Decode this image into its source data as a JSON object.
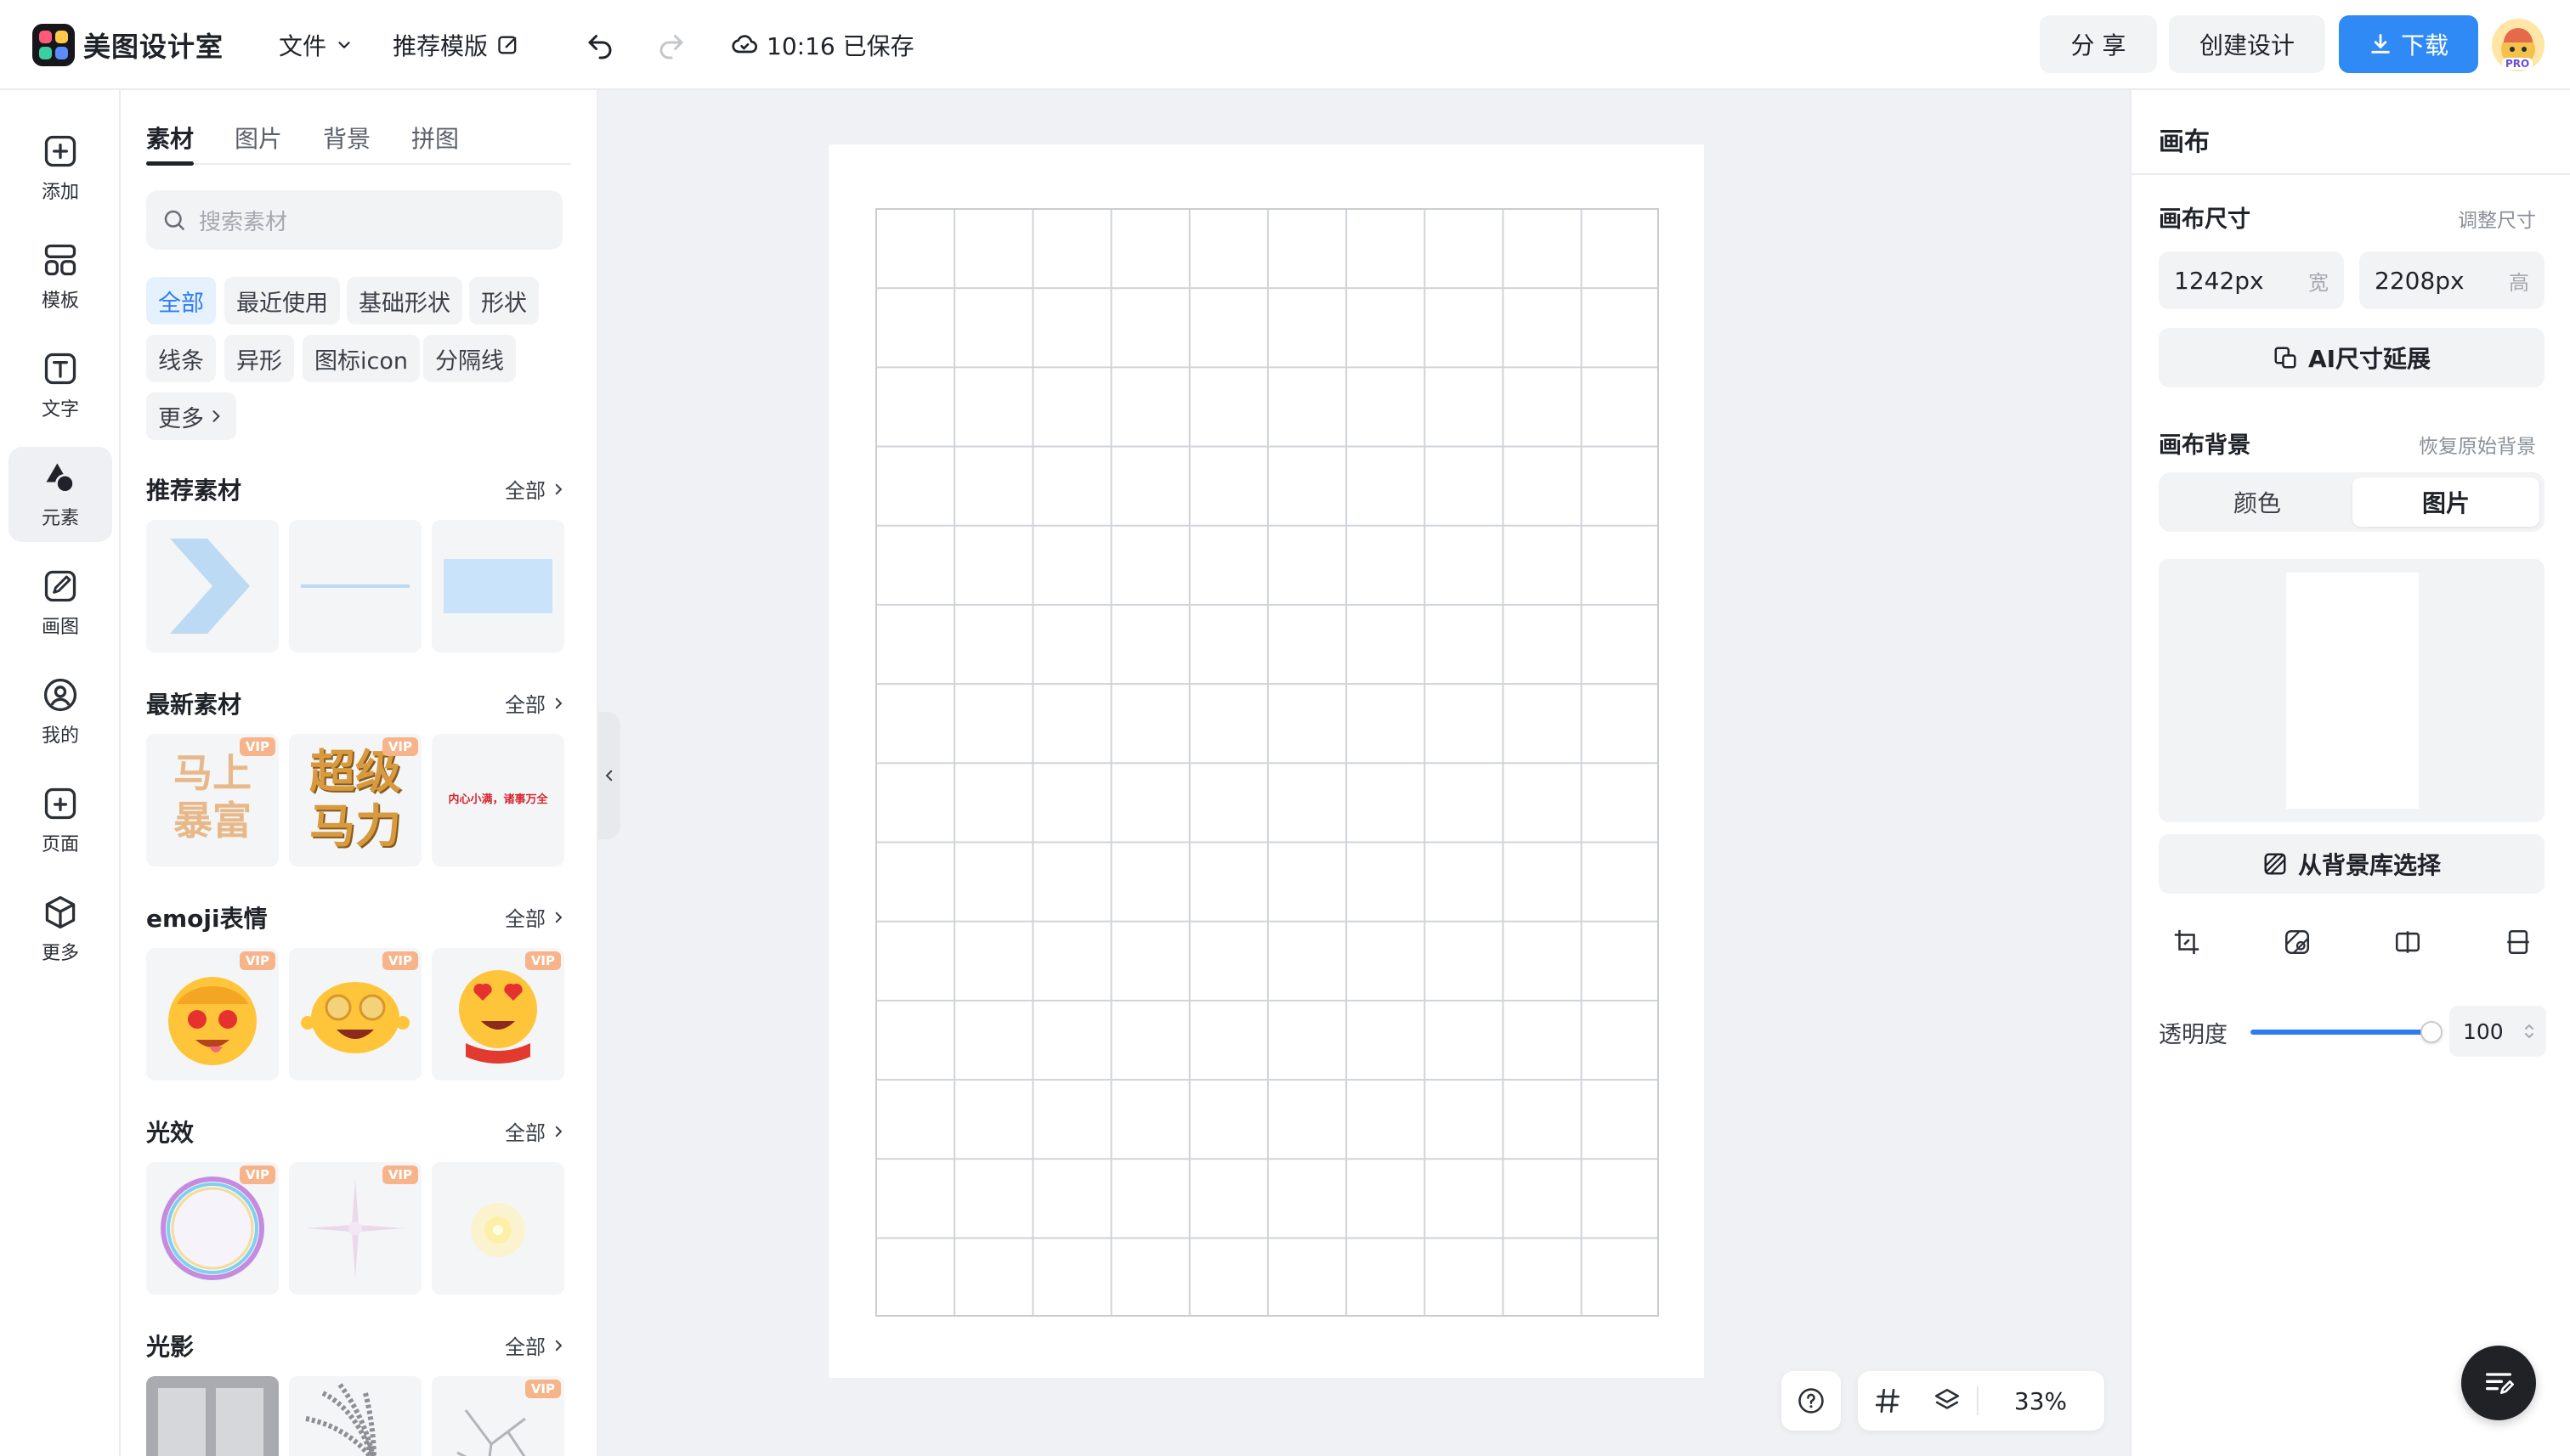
{
  "app": {
    "name": "美图设计室"
  },
  "colors": {
    "accent": "#2d7cf2",
    "vip": "#f7b48b",
    "download": "#2f8af5"
  },
  "topbar": {
    "file_menu": "文件",
    "recommend_template": "推荐模版",
    "save_status": "10:16 已保存",
    "share_label": "分 享",
    "create_label": "创建设计",
    "download_label": "下载",
    "avatar_badge": "PRO"
  },
  "nav": {
    "items": [
      {
        "label": "添加",
        "icon": "plus-square-icon"
      },
      {
        "label": "模板",
        "icon": "template-icon"
      },
      {
        "label": "文字",
        "icon": "text-icon"
      },
      {
        "label": "元素",
        "icon": "shapes-icon"
      },
      {
        "label": "画图",
        "icon": "draw-icon"
      },
      {
        "label": "我的",
        "icon": "user-icon"
      },
      {
        "label": "页面",
        "icon": "page-add-icon"
      },
      {
        "label": "更多",
        "icon": "cube-icon"
      }
    ]
  },
  "panel": {
    "tabs": [
      "素材",
      "图片",
      "背景",
      "拼图"
    ],
    "search_placeholder": "搜索素材",
    "chips": [
      "全部",
      "最近使用",
      "基础形状",
      "形状",
      "线条",
      "异形",
      "图标icon",
      "分隔线",
      "更多"
    ],
    "all_label": "全部",
    "vip_label": "VIP",
    "sections": [
      {
        "title": "推荐素材"
      },
      {
        "title": "最新素材"
      },
      {
        "title": "emoji表情"
      },
      {
        "title": "光效"
      },
      {
        "title": "光影"
      }
    ],
    "sticker_texts": {
      "fortune_line1": "马上",
      "fortune_line2": "暴富",
      "power_line1": "超级",
      "power_line2": "马力",
      "slogan": "内心小满，诸事万全"
    }
  },
  "canvas": {
    "zoom": "33%"
  },
  "right": {
    "title": "画布",
    "size_label": "画布尺寸",
    "resize_link": "调整尺寸",
    "width_value": "1242px",
    "width_unit": "宽",
    "height_value": "2208px",
    "height_unit": "高",
    "ai_extend": "AI尺寸延展",
    "bg_label": "画布背景",
    "restore_link": "恢复原始背景",
    "seg_options": [
      "颜色",
      "图片"
    ],
    "library_btn": "从背景库选择",
    "opacity_label": "透明度",
    "opacity_value": "100"
  }
}
